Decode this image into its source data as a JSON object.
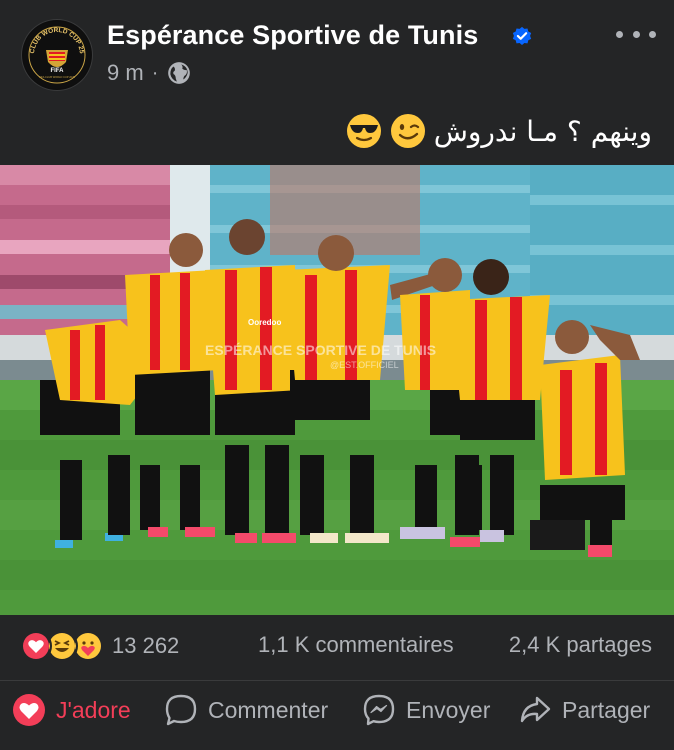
{
  "post": {
    "page_name": "Espérance Sportive de Tunis",
    "avatar": {
      "ring_top": "CLUB WORLD CUP 25",
      "ring_bottom": "FIFA",
      "small_text": "FIFA CLUB WORLD CUP 2025"
    },
    "verified_icon": "verified-badge-icon",
    "more_icon": "more-options-icon",
    "time": "9 m",
    "separator": "·",
    "audience_icon": "globe-icon",
    "caption": "وينهم ؟ مـا ندروش",
    "caption_emojis": [
      "winking-face",
      "smiling-face-with-sunglasses"
    ],
    "photo": {
      "watermark_line1": "ESPÉRANCE SPORTIVE DE TUNIS",
      "watermark_line2": "@EST.OFFICIEL",
      "sponsor": "Ooredoo"
    }
  },
  "stats": {
    "reaction_icons": [
      "love-reaction-icon",
      "haha-reaction-icon",
      "care-reaction-icon"
    ],
    "reactions_count": "13 262",
    "comments": "1,1 K commentaires",
    "shares": "2,4 K partages"
  },
  "actions": {
    "love": "J'adore",
    "comment": "Commenter",
    "send": "Envoyer",
    "share": "Partager"
  },
  "colors": {
    "background": "#242526",
    "text": "#e4e6eb",
    "secondary_text": "#b0b3b8",
    "love_red": "#f33e58",
    "verified_blue": "#0866ff",
    "jersey_red": "#e31b23",
    "jersey_yellow": "#f7c21c"
  }
}
